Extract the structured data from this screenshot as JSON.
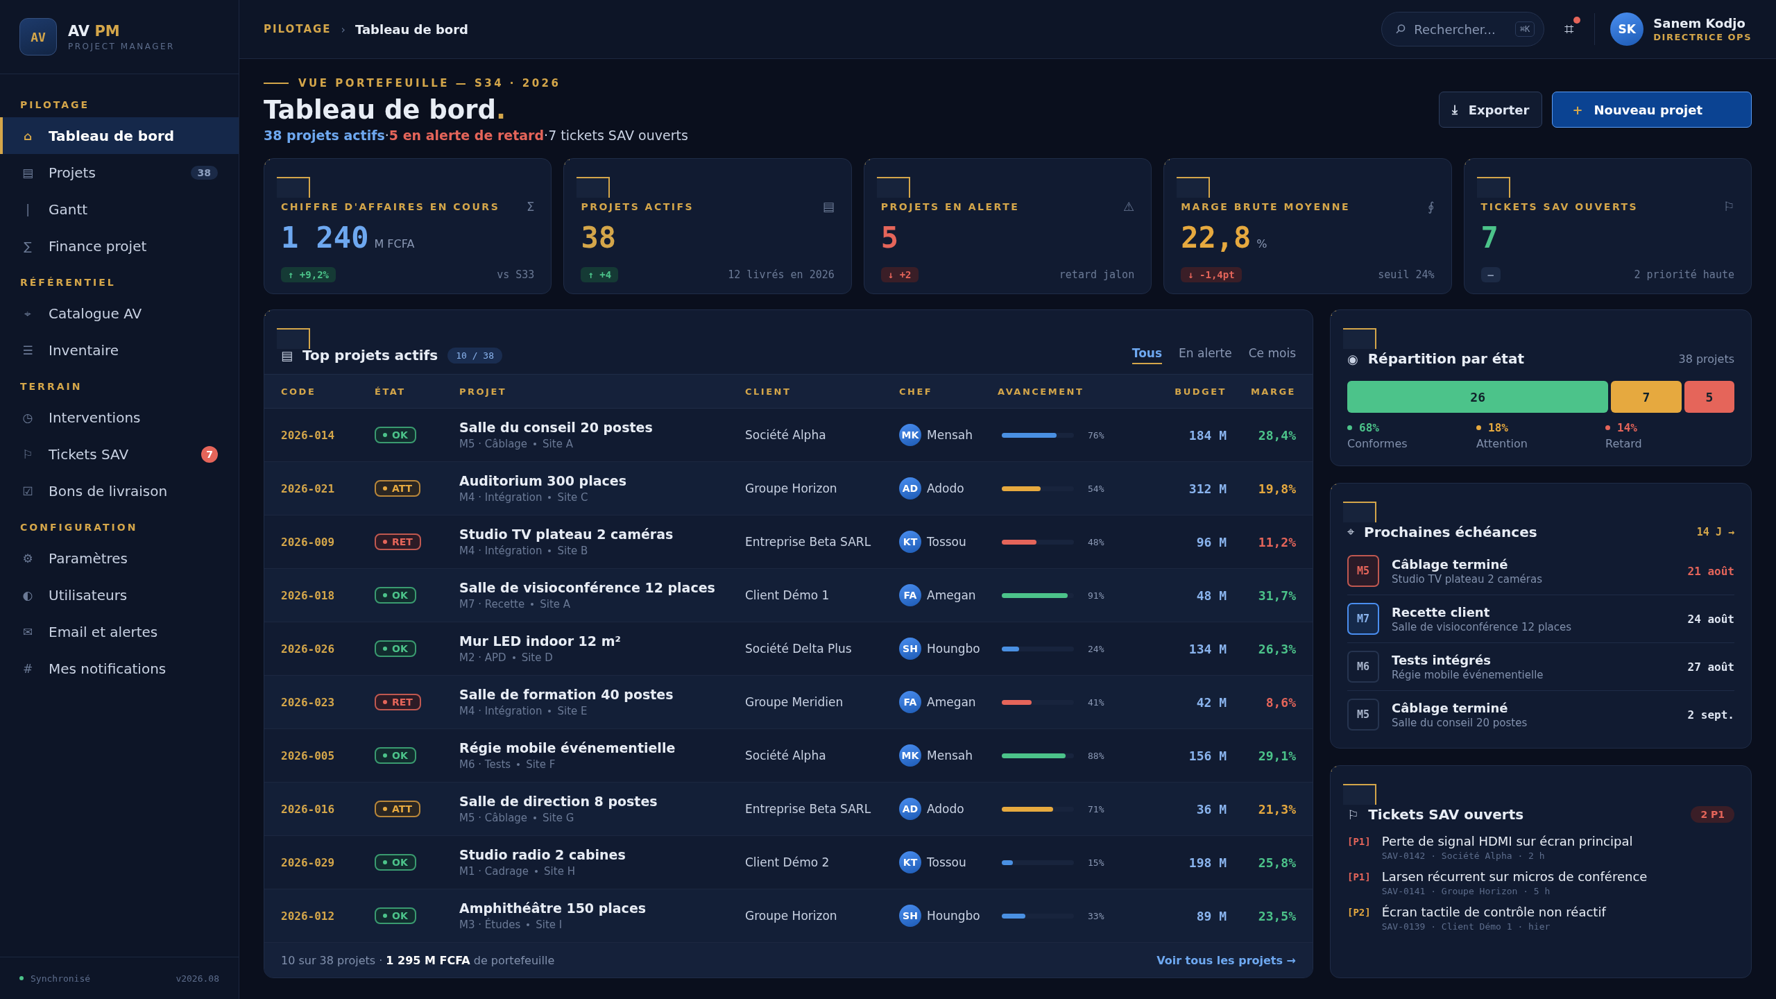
{
  "sidebar": {
    "brand": {
      "logo": "AV",
      "name": "AV",
      "accent": "PM",
      "subtitle": "PROJECT MANAGER"
    },
    "sections": [
      {
        "title": "PILOTAGE",
        "items": [
          {
            "icon": "⌂",
            "label": "Tableau de bord",
            "selected": true
          },
          {
            "icon": "▤",
            "label": "Projets",
            "selected": false,
            "badge": {
              "text": "38",
              "kind": "count"
            }
          },
          {
            "icon": "|",
            "label": "Gantt",
            "selected": false
          },
          {
            "icon": "∑",
            "label": "Finance projet",
            "selected": false
          }
        ]
      },
      {
        "title": "RÉFÉRENTIEL",
        "items": [
          {
            "icon": "⌖",
            "label": "Catalogue AV",
            "selected": false
          },
          {
            "icon": "☰",
            "label": "Inventaire",
            "selected": false
          }
        ]
      },
      {
        "title": "TERRAIN",
        "items": [
          {
            "icon": "◷",
            "label": "Interventions",
            "selected": false
          },
          {
            "icon": "⚐",
            "label": "Tickets SAV",
            "selected": false,
            "badge": {
              "text": "7",
              "kind": "alert"
            }
          },
          {
            "icon": "☑",
            "label": "Bons de livraison",
            "selected": false
          }
        ]
      },
      {
        "title": "CONFIGURATION",
        "items": [
          {
            "icon": "⚙",
            "label": "Paramètres",
            "selected": false
          },
          {
            "icon": "◐",
            "label": "Utilisateurs",
            "selected": false
          },
          {
            "icon": "✉",
            "label": "Email et alertes",
            "selected": false
          },
          {
            "icon": "#",
            "label": "Mes notifications",
            "selected": false
          }
        ]
      }
    ],
    "footer": {
      "status": "Synchronisé",
      "version": "v2026.08"
    }
  },
  "header": {
    "breadcrumb": [
      "PILOTAGE",
      "Tableau de bord"
    ],
    "separator": "›",
    "search": {
      "placeholder": "Rechercher...",
      "shortcut": "⌘K"
    },
    "notifications": {
      "icon": "⌗",
      "unread": true
    },
    "user": {
      "initials": "SK",
      "name": "Sanem Kodjo",
      "role": "DIRECTRICE OPS"
    }
  },
  "page": {
    "eyebrow": "VUE PORTEFEUILLE — S34 · 2026",
    "title": "Tableau de bord",
    "title_mark": ".",
    "summary": {
      "separator": "·",
      "parts": [
        {
          "text": "38 projets actifs",
          "kind": "info"
        },
        {
          "text": "5 en alerte de retard",
          "kind": "alert"
        },
        {
          "text": "7 tickets SAV ouverts",
          "kind": "plain"
        }
      ]
    },
    "buttons": [
      {
        "icon": "⤓",
        "label": "Exporter",
        "kind": "secondary"
      },
      {
        "icon": "+",
        "label": "Nouveau projet",
        "kind": "primary"
      }
    ]
  },
  "kpis": [
    {
      "label": "CHIFFRE D'AFFAIRES EN COURS",
      "icon": "Σ",
      "value": {
        "text": "1 240",
        "kind": "info"
      },
      "unit": "M FCFA",
      "trend": {
        "text": "↑ +9,2%",
        "kind": "up"
      },
      "note": "vs S33"
    },
    {
      "label": "PROJETS ACTIFS",
      "icon": "▤",
      "value": {
        "text": "38",
        "kind": "gold"
      },
      "trend": {
        "text": "↑ +4",
        "kind": "up"
      },
      "note": "12 livrés en 2026"
    },
    {
      "label": "PROJETS EN ALERTE",
      "icon": "⚠",
      "value": {
        "text": "5",
        "kind": "alert"
      },
      "trend": {
        "text": "↓ +2",
        "kind": "down"
      },
      "note": "retard jalon"
    },
    {
      "label": "MARGE BRUTE MOYENNE",
      "icon": "∮",
      "value": {
        "text": "22,8",
        "kind": "warn"
      },
      "unit": "%",
      "trend": {
        "text": "↓ -1,4pt",
        "kind": "down"
      },
      "note": "seuil 24%"
    },
    {
      "label": "TICKETS SAV OUVERTS",
      "icon": "⚐",
      "value": {
        "text": "7",
        "kind": "ok"
      },
      "trend": {
        "text": "—",
        "kind": "flat"
      },
      "note": "2 priorité haute"
    }
  ],
  "table": {
    "icon": "▤",
    "title": "Top projets actifs",
    "count": "10 / 38",
    "filters": [
      {
        "label": "Tous",
        "selected": true
      },
      {
        "label": "En alerte",
        "selected": false
      },
      {
        "label": "Ce mois",
        "selected": false
      }
    ],
    "columns": [
      "CODE",
      "ÉTAT",
      "PROJET",
      "CLIENT",
      "CHEF",
      "AVANCEMENT",
      "BUDGET",
      "MARGE"
    ],
    "rows": [
      {
        "code": "2026-014",
        "status": {
          "label": "OK",
          "kind": "ok"
        },
        "project": "Salle du conseil 20 postes",
        "phase": "M5 · Câblage",
        "site": "Site A",
        "client": "Société Alpha",
        "chef": {
          "initials": "MK",
          "name": "Mensah"
        },
        "level": 0.76,
        "color": "#4a90e2",
        "progress": "76%",
        "budget": "184 M",
        "margin": {
          "text": "28,4%",
          "kind": "ok"
        }
      },
      {
        "code": "2026-021",
        "status": {
          "label": "ATT",
          "kind": "att"
        },
        "project": "Auditorium 300 places",
        "phase": "M4 · Intégration",
        "site": "Site C",
        "client": "Groupe Horizon",
        "chef": {
          "initials": "AD",
          "name": "Adodo"
        },
        "level": 0.54,
        "color": "#e6a93f",
        "progress": "54%",
        "budget": "312 M",
        "margin": {
          "text": "19,8%",
          "kind": "warn"
        }
      },
      {
        "code": "2026-009",
        "status": {
          "label": "RET",
          "kind": "ret"
        },
        "project": "Studio TV plateau 2 caméras",
        "phase": "M4 · Intégration",
        "site": "Site B",
        "client": "Entreprise Beta SARL",
        "chef": {
          "initials": "KT",
          "name": "Tossou"
        },
        "level": 0.48,
        "color": "#e5655a",
        "progress": "48%",
        "budget": "96 M",
        "margin": {
          "text": "11,2%",
          "kind": "alert"
        }
      },
      {
        "code": "2026-018",
        "status": {
          "label": "OK",
          "kind": "ok"
        },
        "project": "Salle de visioconférence 12 places",
        "phase": "M7 · Recette",
        "site": "Site A",
        "client": "Client Démo 1",
        "chef": {
          "initials": "FA",
          "name": "Amegan"
        },
        "level": 0.91,
        "color": "#4cc38a",
        "progress": "91%",
        "budget": "48 M",
        "margin": {
          "text": "31,7%",
          "kind": "ok"
        }
      },
      {
        "code": "2026-026",
        "status": {
          "label": "OK",
          "kind": "ok"
        },
        "project": "Mur LED indoor 12 m²",
        "phase": "M2 · APD",
        "site": "Site D",
        "client": "Société Delta Plus",
        "chef": {
          "initials": "SH",
          "name": "Houngbo"
        },
        "level": 0.24,
        "color": "#4a90e2",
        "progress": "24%",
        "budget": "134 M",
        "margin": {
          "text": "26,3%",
          "kind": "ok"
        }
      },
      {
        "code": "2026-023",
        "status": {
          "label": "RET",
          "kind": "ret"
        },
        "project": "Salle de formation 40 postes",
        "phase": "M4 · Intégration",
        "site": "Site E",
        "client": "Groupe Meridien",
        "chef": {
          "initials": "FA",
          "name": "Amegan"
        },
        "level": 0.41,
        "color": "#e5655a",
        "progress": "41%",
        "budget": "42 M",
        "margin": {
          "text": "8,6%",
          "kind": "alert"
        }
      },
      {
        "code": "2026-005",
        "status": {
          "label": "OK",
          "kind": "ok"
        },
        "project": "Régie mobile événementielle",
        "phase": "M6 · Tests",
        "site": "Site F",
        "client": "Société Alpha",
        "chef": {
          "initials": "MK",
          "name": "Mensah"
        },
        "level": 0.88,
        "color": "#4cc38a",
        "progress": "88%",
        "budget": "156 M",
        "margin": {
          "text": "29,1%",
          "kind": "ok"
        }
      },
      {
        "code": "2026-016",
        "status": {
          "label": "ATT",
          "kind": "att"
        },
        "project": "Salle de direction 8 postes",
        "phase": "M5 · Câblage",
        "site": "Site G",
        "client": "Entreprise Beta SARL",
        "chef": {
          "initials": "AD",
          "name": "Adodo"
        },
        "level": 0.71,
        "color": "#e6a93f",
        "progress": "71%",
        "budget": "36 M",
        "margin": {
          "text": "21,3%",
          "kind": "warn"
        }
      },
      {
        "code": "2026-029",
        "status": {
          "label": "OK",
          "kind": "ok"
        },
        "project": "Studio radio 2 cabines",
        "phase": "M1 · Cadrage",
        "site": "Site H",
        "client": "Client Démo 2",
        "chef": {
          "initials": "KT",
          "name": "Tossou"
        },
        "level": 0.15,
        "color": "#4a90e2",
        "progress": "15%",
        "budget": "198 M",
        "margin": {
          "text": "25,8%",
          "kind": "ok"
        }
      },
      {
        "code": "2026-012",
        "status": {
          "label": "OK",
          "kind": "ok"
        },
        "project": "Amphithéâtre 150 places",
        "phase": "M3 · Études",
        "site": "Site I",
        "client": "Groupe Horizon",
        "chef": {
          "initials": "SH",
          "name": "Houngbo"
        },
        "level": 0.33,
        "color": "#4a90e2",
        "progress": "33%",
        "budget": "89 M",
        "margin": {
          "text": "23,5%",
          "kind": "ok"
        }
      }
    ],
    "footer": {
      "summary": "10 sur 38 projets · **1 295 M FCFA** de portefeuille",
      "link": "Voir tous les projets →"
    }
  },
  "distribution": {
    "icon": "◉",
    "title": "Répartition par état",
    "note": "38 projets",
    "segments": [
      {
        "value": "26",
        "color": "#4cc38a",
        "share": "68%",
        "label": "Conformes"
      },
      {
        "value": "7",
        "color": "#e6a93f",
        "share": "18%",
        "label": "Attention"
      },
      {
        "value": "5",
        "color": "#e5655a",
        "share": "14%",
        "label": "Retard"
      }
    ]
  },
  "deadlines": {
    "icon": "⌖",
    "title": "Prochaines échéances",
    "link": "14 J →",
    "items": [
      {
        "milestone": "M5",
        "title": "Câblage terminé",
        "project": "Studio TV plateau 2 caméras",
        "date": "21 août",
        "kind": "late"
      },
      {
        "milestone": "M7",
        "title": "Recette client",
        "project": "Salle de visioconférence 12 places",
        "date": "24 août",
        "kind": "next"
      },
      {
        "milestone": "M6",
        "title": "Tests intégrés",
        "project": "Régie mobile événementielle",
        "date": "27 août",
        "kind": "normal"
      },
      {
        "milestone": "M5",
        "title": "Câblage terminé",
        "project": "Salle du conseil 20 postes",
        "date": "2 sept.",
        "kind": "normal"
      }
    ]
  },
  "tickets": {
    "icon": "⚐",
    "title": "Tickets SAV ouverts",
    "badge": "2 P1",
    "items": [
      {
        "priority": "[P1]",
        "kind": "p1",
        "title": "Perte de signal HDMI sur écran principal",
        "meta": "SAV-0142 · Société Alpha · 2 h"
      },
      {
        "priority": "[P1]",
        "kind": "p1",
        "title": "Larsen récurrent sur micros de conférence",
        "meta": "SAV-0141 · Groupe Horizon · 5 h"
      },
      {
        "priority": "[P2]",
        "kind": "p2",
        "title": "Écran tactile de contrôle non réactif",
        "meta": "SAV-0139 · Client Démo 1 · hier"
      }
    ]
  }
}
